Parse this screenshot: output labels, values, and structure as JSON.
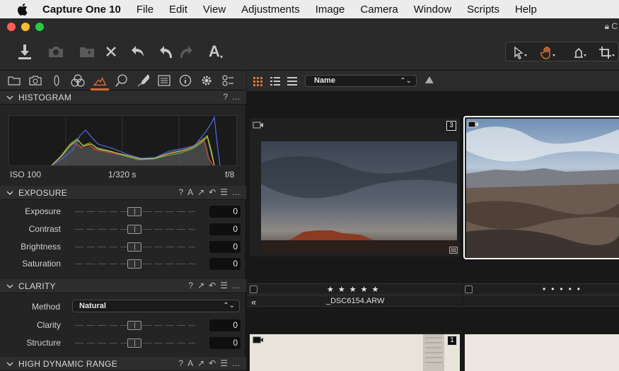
{
  "menubar": {
    "app_name": "Capture One 10",
    "items": [
      "File",
      "Edit",
      "View",
      "Adjustments",
      "Image",
      "Camera",
      "Window",
      "Scripts",
      "Help"
    ]
  },
  "window": {
    "title_fragment": "C"
  },
  "toolbar": {
    "text_tool_label": "A"
  },
  "histogram": {
    "title": "HISTOGRAM",
    "iso": "ISO 100",
    "shutter": "1/320 s",
    "aperture": "f/8",
    "help": "?",
    "more": "…"
  },
  "exposure": {
    "title": "EXPOSURE",
    "auto": "A",
    "help": "?",
    "sliders": [
      {
        "label": "Exposure",
        "value": "0"
      },
      {
        "label": "Contrast",
        "value": "0"
      },
      {
        "label": "Brightness",
        "value": "0"
      },
      {
        "label": "Saturation",
        "value": "0"
      }
    ]
  },
  "clarity": {
    "title": "CLARITY",
    "help": "?",
    "method_label": "Method",
    "method_value": "Natural",
    "sliders": [
      {
        "label": "Clarity",
        "value": "0"
      },
      {
        "label": "Structure",
        "value": "0"
      }
    ]
  },
  "hdr": {
    "title": "HIGH DYNAMIC RANGE",
    "auto": "A",
    "help": "?"
  },
  "browser": {
    "sort_value": "Name",
    "thumbs": [
      {
        "badge": "3",
        "rating": "★★★★★",
        "filename": "_DSC6154.ARW",
        "nav": "«"
      },
      {
        "badge": "",
        "rating": "•••••",
        "filename": ""
      },
      {
        "badge": "1"
      }
    ]
  },
  "colors": {
    "accent": "#d9682a",
    "selection": "#ffffff"
  }
}
